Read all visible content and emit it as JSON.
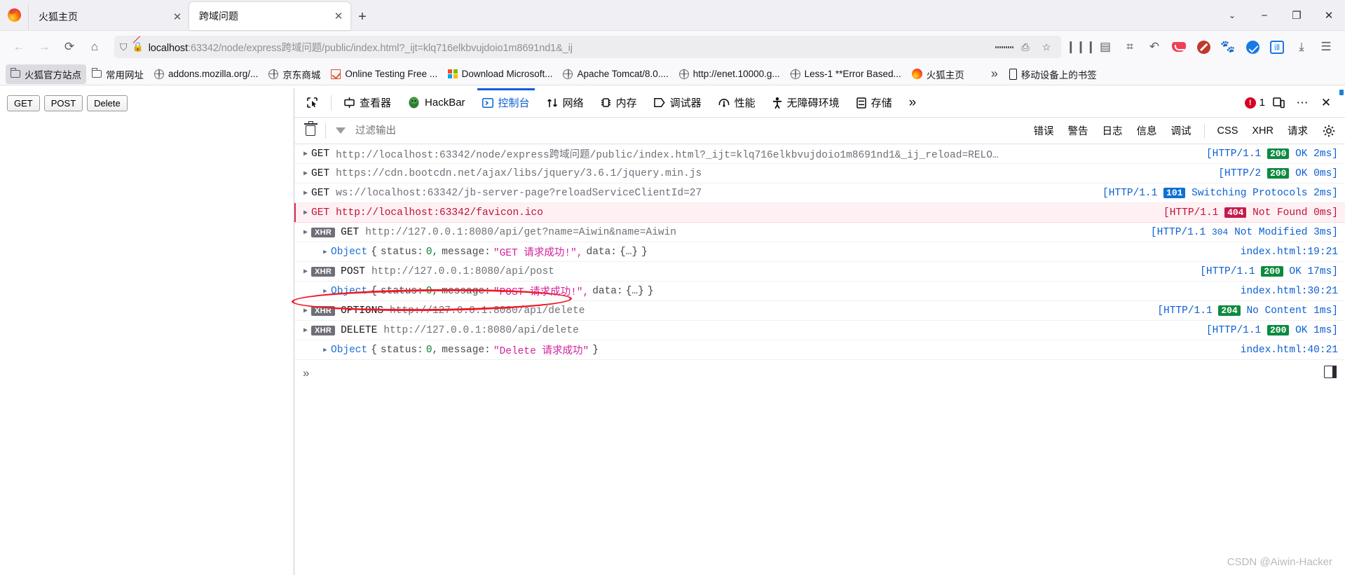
{
  "browser": {
    "tabs": [
      {
        "title": "火狐主页",
        "active": false
      },
      {
        "title": "跨域问题",
        "active": true
      }
    ],
    "newtab_label": "+",
    "window_controls": {
      "chevron": "⌄",
      "minimize": "−",
      "restore": "❐",
      "close": "✕"
    },
    "nav": {
      "back": "←",
      "forward": "→",
      "reload": "⟳",
      "home": "⌂",
      "url_host": "localhost",
      "url_rest": ":63342/node/express跨域问题/public/index.html?_ijt=klq716elkbvujdoio1m8691nd1&_ij",
      "bookmark_star": "☆",
      "reader": "▤",
      "library": "▥",
      "sidebar": "◫",
      "history": "↶",
      "extension_pocket": "pocket-icon",
      "extension_noscript": "noscript-icon",
      "extension_cat": "cat-icon",
      "extension_blue": "blue-check-icon",
      "extension_translate": "译",
      "save": "⤓",
      "menu": "☰"
    },
    "bookmarks": [
      {
        "label": "火狐官方站点",
        "icon": "folder-icon",
        "selected": true
      },
      {
        "label": "常用网址",
        "icon": "folder-icon",
        "selected": false
      },
      {
        "label": "addons.mozilla.org/...",
        "icon": "globe-icon",
        "selected": false
      },
      {
        "label": "京东商城",
        "icon": "globe-icon",
        "selected": false
      },
      {
        "label": "Online Testing Free ...",
        "icon": "checkbox-icon",
        "selected": false
      },
      {
        "label": "Download Microsoft...",
        "icon": "microsoft-icon",
        "selected": false
      },
      {
        "label": "Apache Tomcat/8.0....",
        "icon": "globe-icon",
        "selected": false
      },
      {
        "label": "http://enet.10000.g...",
        "icon": "globe-icon",
        "selected": false
      },
      {
        "label": "Less-1 **Error Based...",
        "icon": "globe-icon",
        "selected": false
      },
      {
        "label": "火狐主页",
        "icon": "firefox-icon",
        "selected": false
      }
    ],
    "bookmarks_overflow": "»",
    "mobile_bookmarks": "移动设备上的书签"
  },
  "page": {
    "buttons": [
      {
        "label": "GET"
      },
      {
        "label": "POST"
      },
      {
        "label": "Delete"
      }
    ]
  },
  "devtools": {
    "picker_icon": "element-picker-icon",
    "tabs": [
      {
        "label": "查看器",
        "icon": "inspector-icon",
        "active": false
      },
      {
        "label": "HackBar",
        "icon": "hackbar-icon",
        "active": false
      },
      {
        "label": "控制台",
        "icon": "console-icon",
        "active": true
      },
      {
        "label": "网络",
        "icon": "network-icon",
        "active": false
      },
      {
        "label": "内存",
        "icon": "memory-icon",
        "active": false
      },
      {
        "label": "调试器",
        "icon": "debugger-icon",
        "active": false
      },
      {
        "label": "性能",
        "icon": "performance-icon",
        "active": false
      },
      {
        "label": "无障碍环境",
        "icon": "accessibility-icon",
        "active": false
      },
      {
        "label": "存储",
        "icon": "storage-icon",
        "active": false
      }
    ],
    "tabs_overflow": "»",
    "error_count": "1",
    "responsive_icon": "responsive-design-icon",
    "meatball_icon": "⋯",
    "close_icon": "✕",
    "filter": {
      "trash_tooltip": "清空",
      "placeholder": "过滤输出",
      "value": "",
      "buttons": [
        "错误",
        "警告",
        "日志",
        "信息",
        "调试"
      ],
      "buttons2": [
        "CSS",
        "XHR",
        "请求"
      ],
      "settings_icon": "gear-icon"
    },
    "logs": [
      {
        "kind": "request",
        "method": "GET",
        "url": "http://localhost:63342/node/express跨域问题/public/index.html?_ijt=klq716elkbvujdoio1m8691nd1&_ij_reload=RELO…",
        "xhr": false,
        "error": false,
        "proto": "[HTTP/1.1",
        "code": "200",
        "code_class": "c200",
        "tail": "OK 2ms]"
      },
      {
        "kind": "request",
        "method": "GET",
        "url": "https://cdn.bootcdn.net/ajax/libs/jquery/3.6.1/jquery.min.js",
        "xhr": false,
        "error": false,
        "proto": "[HTTP/2",
        "code": "200",
        "code_class": "c200",
        "tail": "OK 0ms]"
      },
      {
        "kind": "request",
        "method": "GET",
        "url": "ws://localhost:63342/jb-server-page?reloadServiceClientId=27",
        "xhr": false,
        "error": false,
        "proto": "[HTTP/1.1",
        "code": "101",
        "code_class": "c101",
        "tail": "Switching Protocols 2ms]"
      },
      {
        "kind": "request",
        "method": "GET",
        "url": "http://localhost:63342/favicon.ico",
        "xhr": false,
        "error": true,
        "proto": "[HTTP/1.1",
        "code": "404",
        "code_class": "c404",
        "tail": "Not Found 0ms]"
      },
      {
        "kind": "request",
        "method": "GET",
        "url": "http://127.0.0.1:8080/api/get?name=Aiwin&name=Aiwin",
        "xhr": true,
        "error": false,
        "proto": "[HTTP/1.1",
        "code": "304",
        "code_class": "plain",
        "tail": "Not Modified 3ms]"
      },
      {
        "kind": "object",
        "prefix": "Object",
        "body_status_key": "status:",
        "body_status_val": "0,",
        "body_msg_key": "message:",
        "body_msg_val": "\"GET 请求成功!\",",
        "body_data_key": "data:",
        "body_data_val": "{…}",
        "source": "index.html:19:21"
      },
      {
        "kind": "request",
        "method": "POST",
        "url": "http://127.0.0.1:8080/api/post",
        "xhr": true,
        "error": false,
        "proto": "[HTTP/1.1",
        "code": "200",
        "code_class": "c200",
        "tail": "OK 17ms]"
      },
      {
        "kind": "object",
        "prefix": "Object",
        "body_status_key": "status:",
        "body_status_val": "0,",
        "body_msg_key": "message:",
        "body_msg_val": "\"POST 请求成功!\",",
        "body_data_key": "data:",
        "body_data_val": "{…}",
        "source": "index.html:30:21"
      },
      {
        "kind": "request",
        "method": "OPTIONS",
        "url": "http://127.0.0.1:8080/api/delete",
        "xhr": true,
        "error": false,
        "highlighted": true,
        "proto": "[HTTP/1.1",
        "code": "204",
        "code_class": "c204",
        "tail": "No Content 1ms]"
      },
      {
        "kind": "request",
        "method": "DELETE",
        "url": "http://127.0.0.1:8080/api/delete",
        "xhr": true,
        "error": false,
        "proto": "[HTTP/1.1",
        "code": "200",
        "code_class": "c200",
        "tail": "OK 1ms]"
      },
      {
        "kind": "object",
        "prefix": "Object",
        "body_status_key": "status:",
        "body_status_val": "0,",
        "body_msg_key": "message:",
        "body_msg_val": "\"Delete 请求成功\"",
        "body_data_key": "",
        "body_data_val": "}",
        "source": "index.html:40:21"
      }
    ],
    "prompt_chevron": "»",
    "dock_icon": "dock-to-side-icon"
  },
  "watermark": "CSDN @Aiwin-Hacker",
  "colors": {
    "accent": "#0b5fd4",
    "error": "#c0103a",
    "success": "#0d8a3e",
    "annotation": "#ef1a25",
    "string": "#d3219b"
  }
}
